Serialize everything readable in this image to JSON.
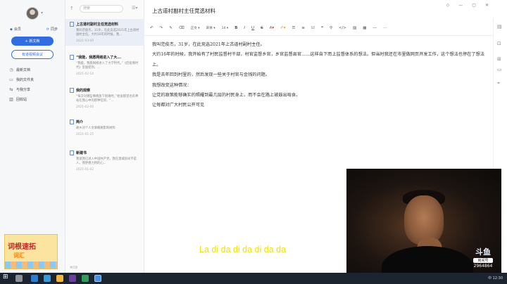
{
  "sidebar": {
    "member_label": "会员",
    "sync_label": "同步",
    "new_button": "+ 新文档",
    "meeting_button": "有道视频会议",
    "items": [
      {
        "icon": "clock-icon",
        "label": "最新文档"
      },
      {
        "icon": "folder-icon",
        "label": "我的文件夹"
      },
      {
        "icon": "share-icon",
        "label": "与我分享"
      },
      {
        "icon": "trash-icon",
        "label": "回收站"
      }
    ],
    "promo": {
      "line1": "词根速拓",
      "line2": "词汇"
    }
  },
  "notelist": {
    "search_placeholder": "搜索",
    "count": "共5项",
    "notes": [
      {
        "title": "上古道村副村主任竞选材料",
        "snippet": "我叫范俊杰，31岁，在此竞选2021年上古道村副村主任。大约16年的时候，我...",
        "date": "2021-03-09"
      },
      {
        "title": "“我能，我愿网络进入了大...",
        "snippet": "“我能，我愿网络进入了大学时代。”《后疫情时代》里面提到，...",
        "date": "2021-02-14"
      },
      {
        "title": "我的观察",
        "snippet": "“每次对哪些事情放下很难时，”他说那里也有神站在我心中的那种信仰，“...",
        "date": "2021-02-04"
      },
      {
        "title": "简介",
        "snippet": "故乡对个人文章概要影响材料",
        "date": "2021-01-25"
      },
      {
        "title": "新建书",
        "snippet": "我说我已进入中国共产党，我在澳城房间不是人，我更想力用的心...",
        "date": "2021-01-02"
      }
    ]
  },
  "editor": {
    "title": "上古道村副村主任竞选材料",
    "toolbar": {
      "format": "正文",
      "font": "宋体",
      "size": "14"
    },
    "paragraphs": [
      "我叫范俊杰，31岁，在此竞选2021年上古道村副村主任。",
      "大约16年的时候，我开始有了村民监督村干部，村官监督乡官，乡官监督县官……这样自下而上监督体系的想法。但当时我还在市里做网页开发工作，这个想法也停在了想法上。",
      "我是去年回到村里的，然后发现一些关于村官与金钱的问题。",
      "我想改变这种情况：",
      "让党的政策能够确实的照耀到最几层的村民身上，而不会在路上被鼓出啃食。",
      "让每都对广大村民公开可见"
    ]
  },
  "stream": {
    "subtitle": "La di da di da di da da",
    "logo_main": "斗鱼",
    "logo_sub": "房间号",
    "room": "2964864"
  },
  "taskbar": {
    "tray_text": "中 12:30"
  }
}
